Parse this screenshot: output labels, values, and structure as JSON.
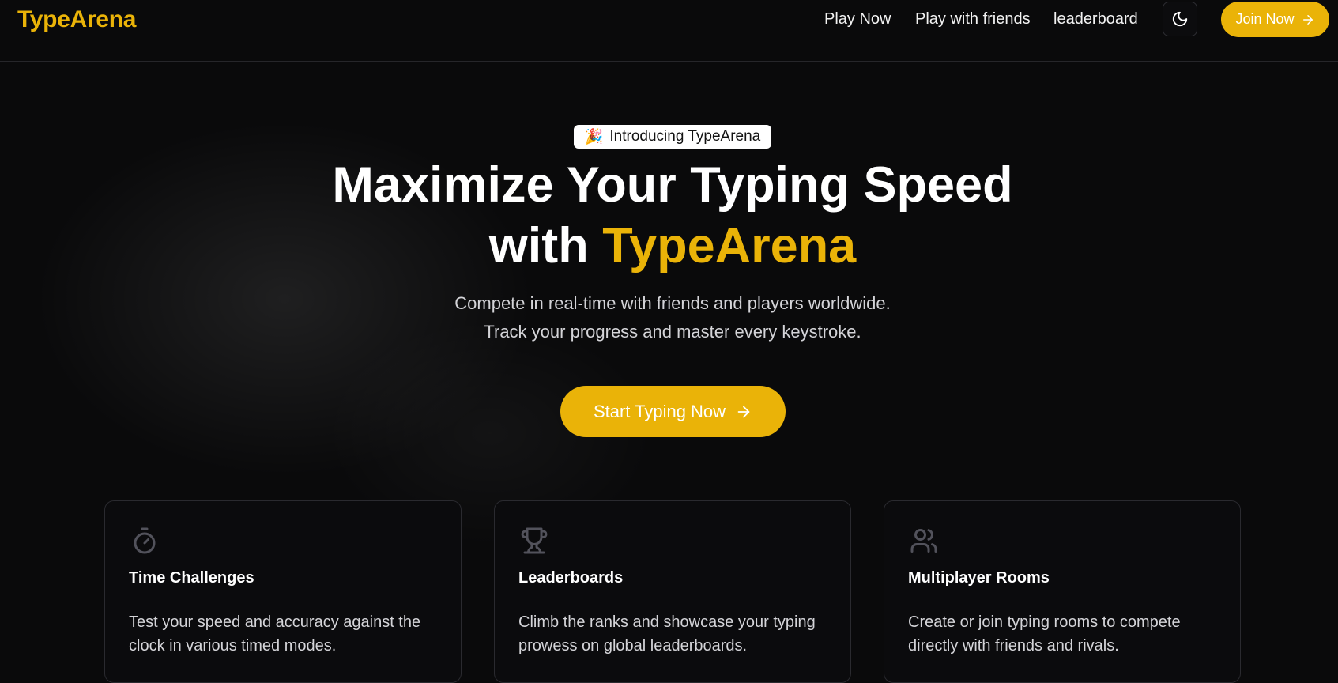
{
  "brand": {
    "name": "TypeArena",
    "accent_color": "#eab308"
  },
  "nav": {
    "links": [
      "Play Now",
      "Play with friends",
      "leaderboard"
    ],
    "theme_toggle_icon": "moon-icon",
    "join_label": "Join Now"
  },
  "hero": {
    "badge_emoji": "🎉",
    "badge_text": "Introducing TypeArena",
    "title_line1": "Maximize Your Typing Speed",
    "title_with": "with",
    "title_brand": "TypeArena",
    "subtitle_line1": "Compete in real-time with friends and players worldwide.",
    "subtitle_line2": "Track your progress and master every keystroke.",
    "cta_label": "Start Typing Now"
  },
  "features": [
    {
      "icon": "stopwatch-icon",
      "title": "Time Challenges",
      "description": "Test your speed and accuracy against the clock in various timed modes."
    },
    {
      "icon": "trophy-icon",
      "title": "Leaderboards",
      "description": "Climb the ranks and showcase your typing prowess on global leaderboards."
    },
    {
      "icon": "users-icon",
      "title": "Multiplayer Rooms",
      "description": "Create or join typing rooms to compete directly with friends and rivals."
    }
  ]
}
